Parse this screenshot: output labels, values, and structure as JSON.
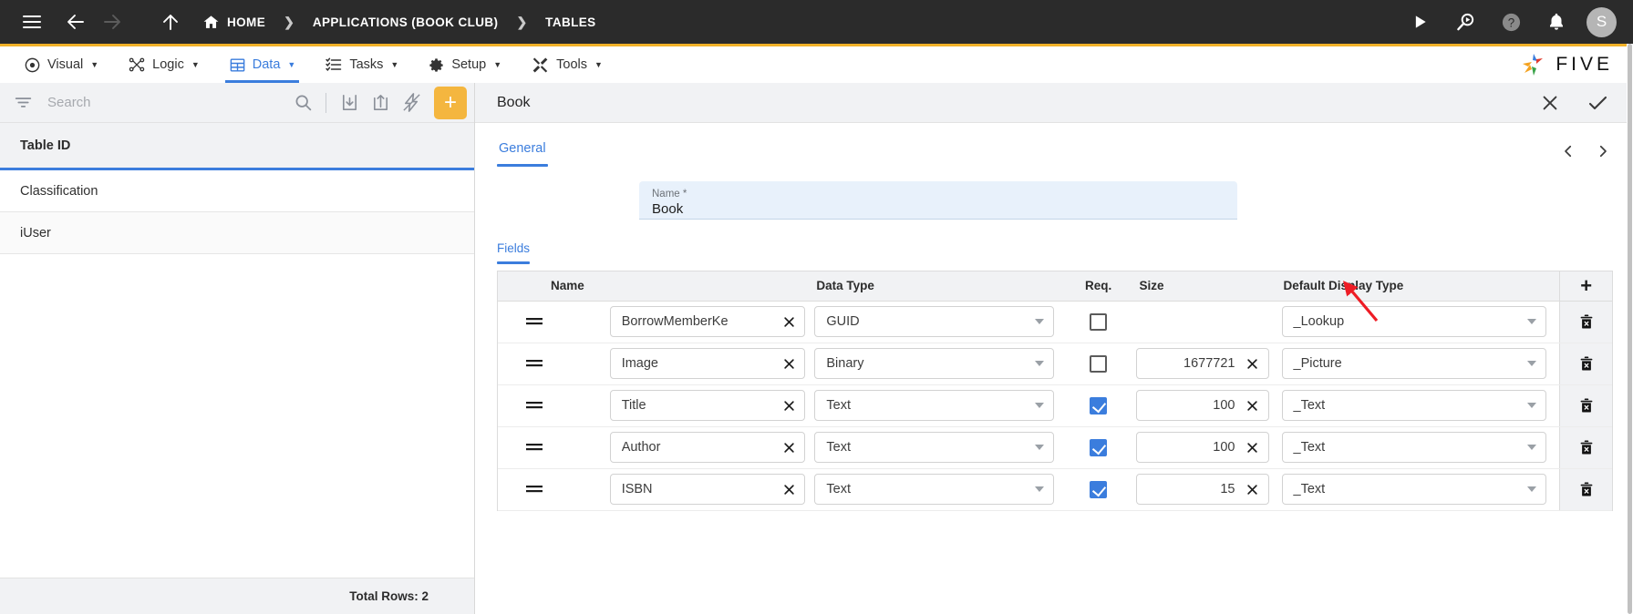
{
  "topbar": {
    "menu_icon": "hamburger-icon",
    "back_icon": "arrow-left-icon",
    "forward_icon": "arrow-right-icon",
    "up_icon": "arrow-up-icon",
    "home_label": "HOME",
    "separator": "❯",
    "breadcrumbs": [
      {
        "label": "APPLICATIONS (BOOK CLUB)"
      },
      {
        "label": "TABLES"
      }
    ],
    "right_icons": [
      "run-icon",
      "search-play-icon",
      "help-icon",
      "bell-icon"
    ],
    "avatar_initial": "S",
    "accent_color": "#f2b229",
    "background": "#2b2b2b"
  },
  "menubar": {
    "items": [
      {
        "label": "Visual",
        "icon": "eye-icon",
        "caret": "▼",
        "active": false
      },
      {
        "label": "Logic",
        "icon": "nodes-icon",
        "caret": "▼",
        "active": false
      },
      {
        "label": "Data",
        "icon": "table-icon",
        "caret": "▼",
        "active": true
      },
      {
        "label": "Tasks",
        "icon": "checklist-icon",
        "caret": "▼",
        "active": false
      },
      {
        "label": "Setup",
        "icon": "gear-icon",
        "caret": "▼",
        "active": false
      },
      {
        "label": "Tools",
        "icon": "tools-icon",
        "caret": "▼",
        "active": false
      }
    ],
    "brand": "FIVE",
    "active_color": "#3b7ddd"
  },
  "sidebar": {
    "search": {
      "placeholder": "Search",
      "value": ""
    },
    "toolbar_icons": [
      "filter-icon",
      "search-icon",
      "import-icon",
      "export-icon",
      "flash-icon"
    ],
    "add_button_label": "+",
    "add_button_color": "#f4b63f",
    "column_header": "Table ID",
    "rows": [
      {
        "label": "Classification"
      },
      {
        "label": "iUser"
      }
    ],
    "footer_label": "Total Rows: 2"
  },
  "detail": {
    "title": "Book",
    "close_icon": "close-icon",
    "confirm_icon": "check-icon",
    "tab": "General",
    "prev_icon": "chevron-left-icon",
    "next_icon": "chevron-right-icon",
    "name_field": {
      "label": "Name *",
      "value": "Book"
    },
    "fields_tab": "Fields"
  },
  "fields_table": {
    "columns": [
      "Name",
      "Data Type",
      "Req.",
      "Size",
      "Default Display Type"
    ],
    "add_row_label": "+",
    "delete_icon": "trash-icon",
    "drag_icon": "drag-handle-icon",
    "clear_icon": "clear-x-icon",
    "rows": [
      {
        "name": "BorrowMemberKe",
        "data_type": "GUID",
        "required": false,
        "size": "",
        "display_type": "_Lookup"
      },
      {
        "name": "Image",
        "data_type": "Binary",
        "required": false,
        "size": "1677721",
        "display_type": "_Picture"
      },
      {
        "name": "Title",
        "data_type": "Text",
        "required": true,
        "size": "100",
        "display_type": "_Text"
      },
      {
        "name": "Author",
        "data_type": "Text",
        "required": true,
        "size": "100",
        "display_type": "_Text"
      },
      {
        "name": "ISBN",
        "data_type": "Text",
        "required": true,
        "size": "15",
        "display_type": "_Text"
      }
    ]
  },
  "annotation": {
    "type": "arrow",
    "color": "#ee1c25",
    "points_to": "add-field-row-button"
  }
}
